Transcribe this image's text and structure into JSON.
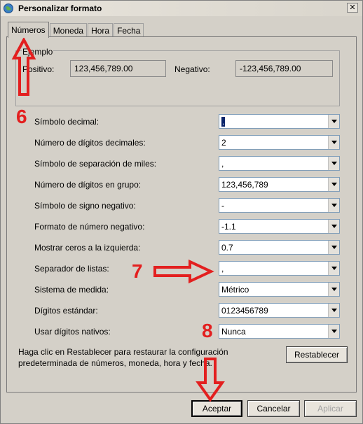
{
  "window": {
    "title": "Personalizar formato",
    "close_glyph": "✕"
  },
  "tabs": [
    "Números",
    "Moneda",
    "Hora",
    "Fecha"
  ],
  "example": {
    "group_label": "Ejemplo",
    "positive_label": "Positivo:",
    "positive_value": "123,456,789.00",
    "negative_label": "Negativo:",
    "negative_value": "-123,456,789.00"
  },
  "settings": [
    {
      "label": "Símbolo decimal:",
      "value": "."
    },
    {
      "label": "Número de dígitos decimales:",
      "value": "2"
    },
    {
      "label": "Símbolo de separación de miles:",
      "value": ","
    },
    {
      "label": "Número de dígitos en grupo:",
      "value": "123,456,789"
    },
    {
      "label": "Símbolo de signo negativo:",
      "value": "-"
    },
    {
      "label": "Formato de número negativo:",
      "value": "-1.1"
    },
    {
      "label": "Mostrar ceros a la izquierda:",
      "value": "0.7"
    },
    {
      "label": "Separador de listas:",
      "value": ","
    },
    {
      "label": "Sistema de medida:",
      "value": "Métrico"
    },
    {
      "label": "Dígitos estándar:",
      "value": "0123456789"
    },
    {
      "label": "Usar dígitos nativos:",
      "value": "Nunca"
    }
  ],
  "description": {
    "line1": "Haga clic en Restablecer para restaurar la configuración",
    "line2": "predeterminada de números, moneda, hora y fecha."
  },
  "buttons": {
    "reset": "Restablecer",
    "ok": "Aceptar",
    "cancel": "Cancelar",
    "apply": "Aplicar"
  },
  "annotations": {
    "n6": "6",
    "n7": "7",
    "n8": "8",
    "color": "#e31f1f"
  }
}
